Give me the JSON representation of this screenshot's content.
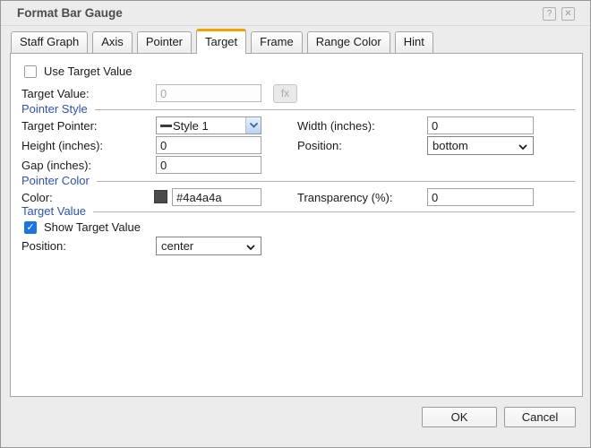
{
  "window": {
    "title": "Format Bar Gauge"
  },
  "icons": {
    "help": "?",
    "close": "✕",
    "check": "✓"
  },
  "colors": {
    "tab_accent": "#f2a200",
    "section_header": "#2b50c8",
    "checkbox_checked": "#1a73e8"
  },
  "tabs": [
    {
      "label": "Staff Graph",
      "active": false
    },
    {
      "label": "Axis",
      "active": false
    },
    {
      "label": "Pointer",
      "active": false
    },
    {
      "label": "Target",
      "active": true
    },
    {
      "label": "Frame",
      "active": false
    },
    {
      "label": "Range Color",
      "active": false
    },
    {
      "label": "Hint",
      "active": false
    }
  ],
  "form": {
    "use_target_value": {
      "label": "Use Target Value",
      "checked": false
    },
    "target_value": {
      "label": "Target Value:",
      "value": "0",
      "fx": "fx",
      "disabled": true
    },
    "pointer_style": {
      "header": "Pointer Style",
      "target_pointer": {
        "label": "Target Pointer:",
        "value": "Style 1"
      },
      "width": {
        "label": "Width (inches):",
        "value": "0"
      },
      "height": {
        "label": "Height (inches):",
        "value": "0"
      },
      "position": {
        "label": "Position:",
        "value": "bottom"
      },
      "gap": {
        "label": "Gap (inches):",
        "value": "0"
      }
    },
    "pointer_color": {
      "header": "Pointer Color",
      "color": {
        "label": "Color:",
        "value": "#4a4a4a",
        "swatch": "#4a4a4a"
      },
      "transparency": {
        "label": "Transparency (%):",
        "value": "0"
      }
    },
    "target_value_section": {
      "header": "Target Value",
      "show_target_value": {
        "label": "Show Target Value",
        "checked": true
      },
      "position": {
        "label": "Position:",
        "value": "center"
      }
    }
  },
  "footer": {
    "ok": "OK",
    "cancel": "Cancel"
  }
}
